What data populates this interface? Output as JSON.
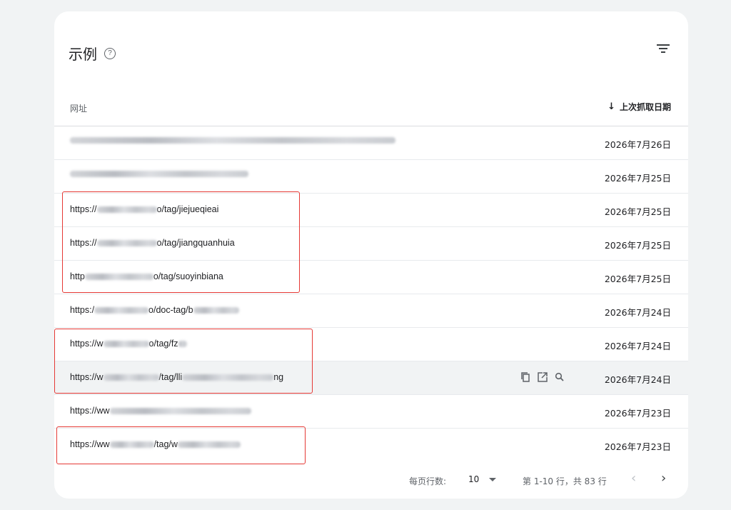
{
  "header": {
    "title": "示例",
    "help_icon": "help-circle-icon",
    "filter_icon": "filter-icon"
  },
  "columns": {
    "url": "网址",
    "date": "上次抓取日期",
    "sort_icon": "arrow-down-icon"
  },
  "rows": [
    {
      "url_prefix": "",
      "url_suffix": "",
      "date": "2026年7月26日"
    },
    {
      "url_prefix": "",
      "url_suffix": "",
      "date": "2026年7月25日"
    },
    {
      "url_prefix": "https://",
      "url_suffix": "o/tag/jiejueqieai",
      "date": "2026年7月25日"
    },
    {
      "url_prefix": "https://",
      "url_suffix": "o/tag/jiangquanhuia",
      "date": "2026年7月25日"
    },
    {
      "url_prefix": "http",
      "url_suffix": "o/tag/suoyinbiana",
      "date": "2026年7月25日"
    },
    {
      "url_prefix": "https:/",
      "url_suffix": "o/doc-tag/b",
      "date": "2026年7月24日"
    },
    {
      "url_prefix": "https://w",
      "url_suffix": "o/tag/fz",
      "date": "2026年7月24日"
    },
    {
      "url_prefix": "https://w",
      "url_suffix": "/tag/lli",
      "url_tail": "ng",
      "date": "2026年7月24日"
    },
    {
      "url_prefix": "https://ww",
      "url_suffix": "",
      "date": "2026年7月23日"
    },
    {
      "url_prefix": "https://ww",
      "url_suffix": "/tag/w",
      "date": "2026年7月23日"
    }
  ],
  "row_actions": [
    "copy-icon",
    "open-in-new-icon",
    "search-icon"
  ],
  "pagination": {
    "rows_per_page_label": "每页行数:",
    "rows_per_page_value": "10",
    "range_text": "第 1-10 行，共 83 行",
    "prev_icon": "chevron-left-icon",
    "next_icon": "chevron-right-icon"
  },
  "colors": {
    "highlight_box": "#e53935",
    "background": "#f1f3f4",
    "card": "#ffffff"
  }
}
